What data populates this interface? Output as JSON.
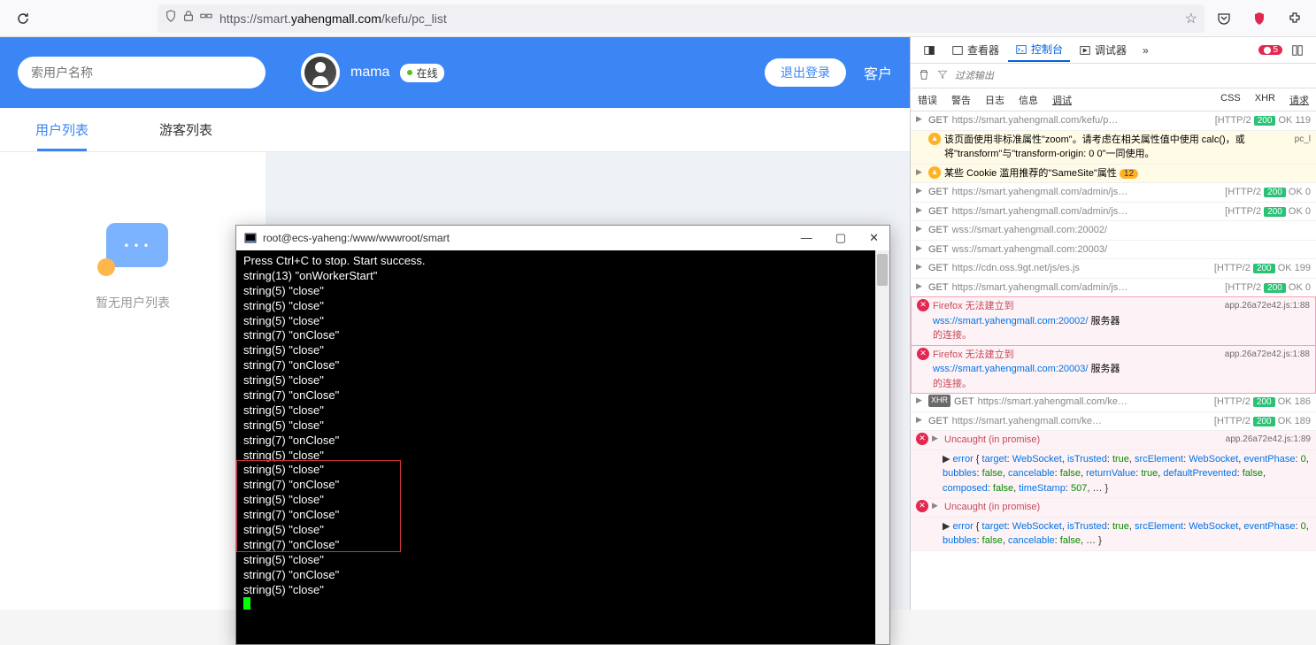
{
  "browser": {
    "url_prefix": "https://smart.",
    "url_host": "yahengmall.com",
    "url_path": "/kefu/pc_list",
    "error_count": "5"
  },
  "app": {
    "search_placeholder": "索用户名称",
    "username": "mama",
    "status": "在线",
    "logout": "退出登录",
    "nav_right": "客户",
    "tab1": "用户列表",
    "tab2": "游客列表",
    "empty": "暂无用户列表"
  },
  "terminal": {
    "title": "root@ecs-yaheng:/www/wwwroot/smart",
    "lines": [
      "Press Ctrl+C to stop. Start success.",
      "string(13) \"onWorkerStart\"",
      "string(5) \"close\"",
      "string(5) \"close\"",
      "string(5) \"close\"",
      "string(7) \"onClose\"",
      "string(5) \"close\"",
      "string(7) \"onClose\"",
      "string(5) \"close\"",
      "string(7) \"onClose\"",
      "string(5) \"close\"",
      "string(5) \"close\"",
      "string(7) \"onClose\"",
      "string(5) \"close\"",
      "string(5) \"close\"",
      "string(7) \"onClose\"",
      "string(5) \"close\"",
      "string(7) \"onClose\"",
      "string(5) \"close\"",
      "string(7) \"onClose\"",
      "string(5) \"close\"",
      "string(7) \"onClose\"",
      "string(5) \"close\""
    ]
  },
  "devtools": {
    "inspector": "查看器",
    "console": "控制台",
    "debugger": "调试器",
    "filter_placeholder": "过滤输出",
    "filters": {
      "err": "错误",
      "warn": "警告",
      "log": "日志",
      "info": "信息",
      "debug": "调试",
      "css": "CSS",
      "xhr": "XHR",
      "req": "请求"
    },
    "logs": [
      {
        "type": "log",
        "expand": true,
        "method": "GET",
        "url": "https://smart.yahengmall.com/kefu/p…",
        "status": "[HTTP/2 200 OK 119"
      },
      {
        "type": "warn",
        "msg": "该页面使用非标准属性\"zoom\"。请考虑在相关属性值中使用 calc()，或将\"transform\"与\"transform-origin: 0 0\"一同使用。",
        "link": "pc_l"
      },
      {
        "type": "warn",
        "expand": true,
        "msg": "某些 Cookie 滥用推荐的\"SameSite\"属性",
        "badge": "12"
      },
      {
        "type": "log",
        "expand": true,
        "method": "GET",
        "url": "https://smart.yahengmall.com/admin/js…",
        "status": "[HTTP/2 200 OK 0"
      },
      {
        "type": "log",
        "expand": true,
        "method": "GET",
        "url": "https://smart.yahengmall.com/admin/js…",
        "status": "[HTTP/2 200 OK 0"
      },
      {
        "type": "log",
        "expand": true,
        "method": "GET",
        "url": "wss://smart.yahengmall.com:20002/"
      },
      {
        "type": "log",
        "expand": true,
        "method": "GET",
        "url": "wss://smart.yahengmall.com:20003/"
      },
      {
        "type": "log",
        "expand": true,
        "method": "GET",
        "url": "https://cdn.oss.9gt.net/js/es.js",
        "status": "[HTTP/2 200 OK 199"
      },
      {
        "type": "log",
        "expand": true,
        "method": "GET",
        "url": "https://smart.yahengmall.com/admin/js…",
        "status": "[HTTP/2 200 OK 0"
      },
      {
        "type": "error-box",
        "lines": [
          "Firefox 无法建立到",
          "wss://smart.yahengmall.com:20002/ 服务器",
          "的连接。"
        ],
        "link": "app.26a72e42.js:1:88"
      },
      {
        "type": "error-box",
        "lines": [
          "Firefox 无法建立到",
          "wss://smart.yahengmall.com:20003/ 服务器",
          "的连接。"
        ],
        "link": "app.26a72e42.js:1:88"
      },
      {
        "type": "log",
        "expand": true,
        "xhr": true,
        "method": "GET",
        "url": "https://smart.yahengmall.com/ke…",
        "status": "[HTTP/2 200 OK 186"
      },
      {
        "type": "log",
        "expand": true,
        "method": "GET",
        "url": "https://smart.yahengmall.com/ke…",
        "status": "[HTTP/2 200 OK 189"
      }
    ],
    "uncaught_header": "Uncaught (in promise)",
    "uncaught1": {
      "link": "app.26a72e42.js:1:89",
      "text_parts": [
        [
          "▶ ",
          "punct"
        ],
        [
          "error ",
          "key"
        ],
        [
          "{ ",
          "punct"
        ],
        [
          "target",
          "key"
        ],
        [
          ": ",
          "punct"
        ],
        [
          "WebSocket",
          "str"
        ],
        [
          ", ",
          "punct"
        ],
        [
          "isTrusted",
          "key"
        ],
        [
          ": ",
          "punct"
        ],
        [
          "true",
          "bool"
        ],
        [
          ", ",
          "punct"
        ],
        [
          "srcElement",
          "key"
        ],
        [
          ": ",
          "punct"
        ],
        [
          "WebSocket",
          "str"
        ],
        [
          ", ",
          "punct"
        ],
        [
          "eventPhase",
          "key"
        ],
        [
          ": ",
          "punct"
        ],
        [
          "0",
          "num"
        ],
        [
          ", ",
          "punct"
        ],
        [
          "bubbles",
          "key"
        ],
        [
          ": ",
          "punct"
        ],
        [
          "false",
          "bool"
        ],
        [
          ", ",
          "punct"
        ],
        [
          "cancelable",
          "key"
        ],
        [
          ": ",
          "punct"
        ],
        [
          "false",
          "bool"
        ],
        [
          ", ",
          "punct"
        ],
        [
          "returnValue",
          "key"
        ],
        [
          ": ",
          "punct"
        ],
        [
          "true",
          "bool"
        ],
        [
          ", ",
          "punct"
        ],
        [
          "defaultPrevented",
          "key"
        ],
        [
          ": ",
          "punct"
        ],
        [
          "false",
          "bool"
        ],
        [
          ", ",
          "punct"
        ],
        [
          "composed",
          "key"
        ],
        [
          ": ",
          "punct"
        ],
        [
          "false",
          "bool"
        ],
        [
          ", ",
          "punct"
        ],
        [
          "timeStamp",
          "key"
        ],
        [
          ": ",
          "punct"
        ],
        [
          "507",
          "num"
        ],
        [
          ", … }",
          "punct"
        ]
      ]
    },
    "uncaught2": {
      "text_parts": [
        [
          "▶ ",
          "punct"
        ],
        [
          "error ",
          "key"
        ],
        [
          "{ ",
          "punct"
        ],
        [
          "target",
          "key"
        ],
        [
          ": ",
          "punct"
        ],
        [
          "WebSocket",
          "str"
        ],
        [
          ", ",
          "punct"
        ],
        [
          "isTrusted",
          "key"
        ],
        [
          ": ",
          "punct"
        ],
        [
          "true",
          "bool"
        ],
        [
          ", ",
          "punct"
        ],
        [
          "srcElement",
          "key"
        ],
        [
          ": ",
          "punct"
        ],
        [
          "WebSocket",
          "str"
        ],
        [
          ", ",
          "punct"
        ],
        [
          "eventPhase",
          "key"
        ],
        [
          ": ",
          "punct"
        ],
        [
          "0",
          "num"
        ],
        [
          ", ",
          "punct"
        ],
        [
          "bubbles",
          "key"
        ],
        [
          ": ",
          "punct"
        ],
        [
          "false",
          "bool"
        ],
        [
          ", ",
          "punct"
        ],
        [
          "cancelable",
          "key"
        ],
        [
          ": ",
          "punct"
        ],
        [
          "false",
          "bool"
        ],
        [
          ", … }",
          "punct"
        ]
      ]
    }
  }
}
